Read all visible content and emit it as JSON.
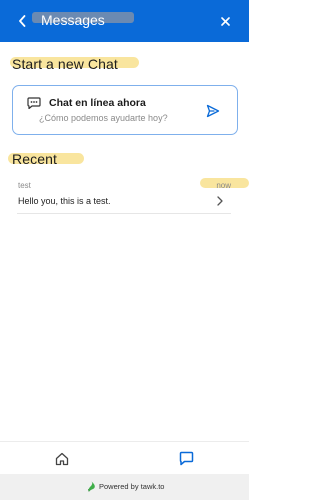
{
  "header": {
    "title": "Messages",
    "background": "#0a6ad8",
    "back_icon": "chevron-left-icon",
    "close_icon": "close-icon"
  },
  "start_section": {
    "title": "Start a new Chat",
    "card": {
      "title": "Chat en línea ahora",
      "subtitle": "¿Cómo podemos ayudarte hoy?",
      "chat_icon": "chat-bubble-icon",
      "send_icon": "send-icon",
      "border_color": "#7fb0ec"
    }
  },
  "recent_section": {
    "title": "Recent",
    "conversations": [
      {
        "name": "test",
        "time": "now",
        "message": "Hello you, this is a test."
      }
    ]
  },
  "bottom_nav": {
    "items": [
      {
        "icon": "home-icon",
        "active": false
      },
      {
        "icon": "chat-icon",
        "active": true
      }
    ]
  },
  "footer": {
    "text": "Powered by tawk.to",
    "logo": "tawk-logo"
  },
  "colors": {
    "accent": "#0a6ad8",
    "highlight": "#f7dc7d"
  }
}
